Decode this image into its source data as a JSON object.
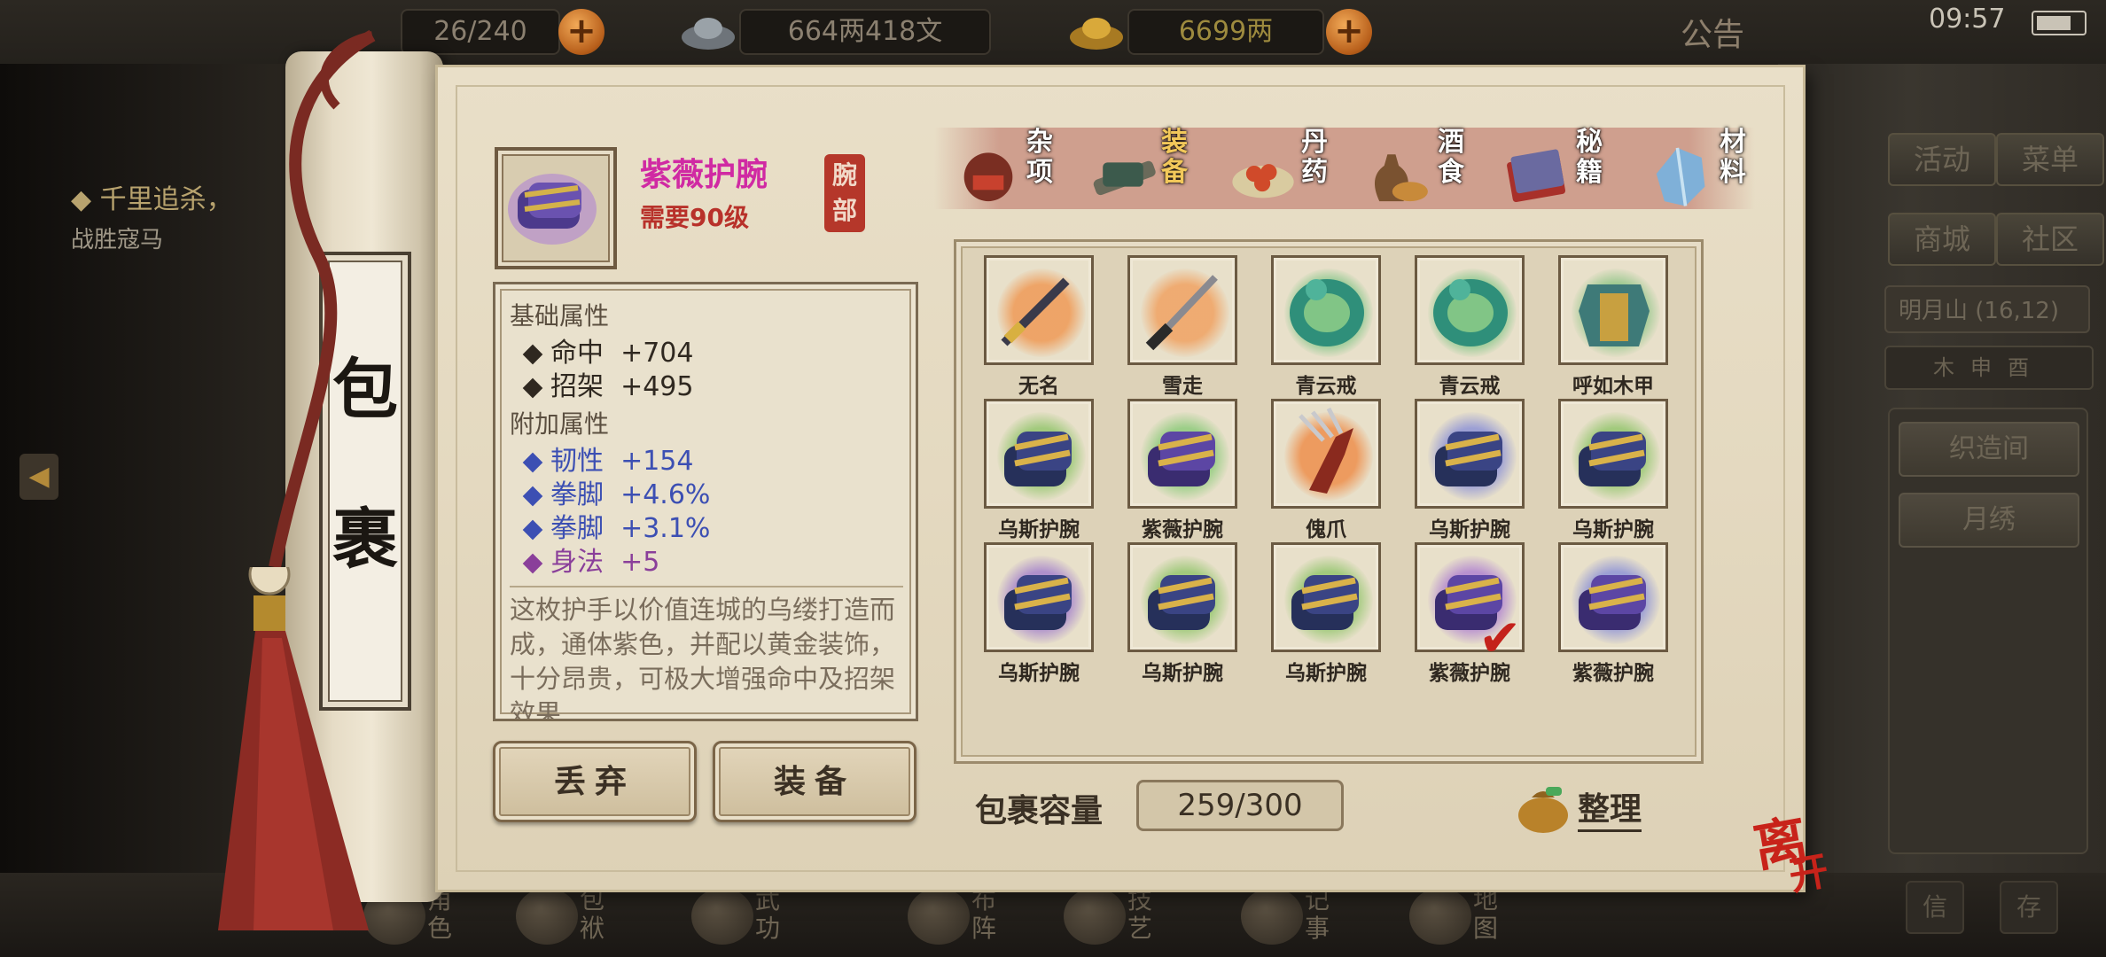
{
  "topbar": {
    "capacity_fragment": "26/240",
    "silver": "664两418文",
    "gold": "6699两",
    "announcement": "公告",
    "clock": "09:57"
  },
  "quest": {
    "title": "千里追杀，",
    "subtitle": "战胜寇马"
  },
  "sidebar": {
    "activity": "活动",
    "menu": "菜单",
    "shop": "商城",
    "community": "社区",
    "location": "明月山 (16,12)",
    "weave_room": "织造间",
    "embroidery": "月绣",
    "mini1": "信",
    "mini2": "存"
  },
  "bottom_nav": [
    {
      "label": "角色"
    },
    {
      "label": "包袱"
    },
    {
      "label": "武功"
    },
    {
      "label": "布阵"
    },
    {
      "label": "技艺"
    },
    {
      "label": "记事"
    },
    {
      "label": "地图"
    }
  ],
  "scroll": {
    "title_1": "包",
    "title_2": "裹"
  },
  "item": {
    "name": "紫薇护腕",
    "level_req": "需要90级",
    "slot": "腕部",
    "base_header": "基础属性",
    "base_stats": [
      {
        "name": "命中",
        "value": "+704"
      },
      {
        "name": "招架",
        "value": "+495"
      }
    ],
    "extra_header": "附加属性",
    "extra_stats": [
      {
        "name": "韧性",
        "value": "+154"
      },
      {
        "name": "拳脚",
        "value": "+4.6%"
      },
      {
        "name": "拳脚",
        "value": "+3.1%"
      },
      {
        "name": "身法",
        "value": "+5"
      }
    ],
    "description": "这枚护手以价值连城的乌缕打造而成，通体紫色，并配以黄金装饰，十分昂贵，可极大增强命中及招架效果"
  },
  "buttons": {
    "discard": "丢弃",
    "equip": "装备",
    "sort": "整理",
    "leave_1": "离",
    "leave_2": "开"
  },
  "tabs": [
    {
      "label": "杂项",
      "active": false
    },
    {
      "label": "装备",
      "active": true
    },
    {
      "label": "丹药",
      "active": false
    },
    {
      "label": "酒食",
      "active": false
    },
    {
      "label": "秘籍",
      "active": false
    },
    {
      "label": "材料",
      "active": false
    }
  ],
  "grid": [
    {
      "name": "无名",
      "kind": "dagger",
      "ink": "#ef9a56"
    },
    {
      "name": "雪走",
      "kind": "katana",
      "ink": "#f0a262"
    },
    {
      "name": "青云戒",
      "kind": "ring",
      "ink": "#6fc07a"
    },
    {
      "name": "青云戒",
      "kind": "ring",
      "ink": "#6fc07a"
    },
    {
      "name": "呼如木甲",
      "kind": "armor",
      "ink": "#8cc484"
    },
    {
      "name": "乌斯护腕",
      "kind": "bracer",
      "ink": "#95c66f"
    },
    {
      "name": "紫薇护腕",
      "kind": "bracer-purple",
      "ink": "#8ecb7c"
    },
    {
      "name": "傀爪",
      "kind": "claw",
      "ink": "#ee8f4c"
    },
    {
      "name": "乌斯护腕",
      "kind": "bracer",
      "ink": "#8f94d6"
    },
    {
      "name": "乌斯护腕",
      "kind": "bracer",
      "ink": "#95c66f"
    },
    {
      "name": "乌斯护腕",
      "kind": "bracer",
      "ink": "#a482cc"
    },
    {
      "name": "乌斯护腕",
      "kind": "bracer",
      "ink": "#95c66f"
    },
    {
      "name": "乌斯护腕",
      "kind": "bracer",
      "ink": "#95c66f"
    },
    {
      "name": "紫薇护腕",
      "kind": "bracer-purple",
      "ink": "#b083d0",
      "equipped": true
    },
    {
      "name": "紫薇护腕",
      "kind": "bracer-purple",
      "ink": "#8f94d6"
    }
  ],
  "capacity": {
    "label": "包裹容量",
    "value": "259/300"
  },
  "colors": {
    "item_name": "#d02aa3",
    "level_req": "#b8312a",
    "base_stat": "#2f2820",
    "extra_stat": "#3c4fb3",
    "extra_stat_last": "#8a3f9a",
    "tab_active": "#f2c85a",
    "check": "#c4221b"
  }
}
